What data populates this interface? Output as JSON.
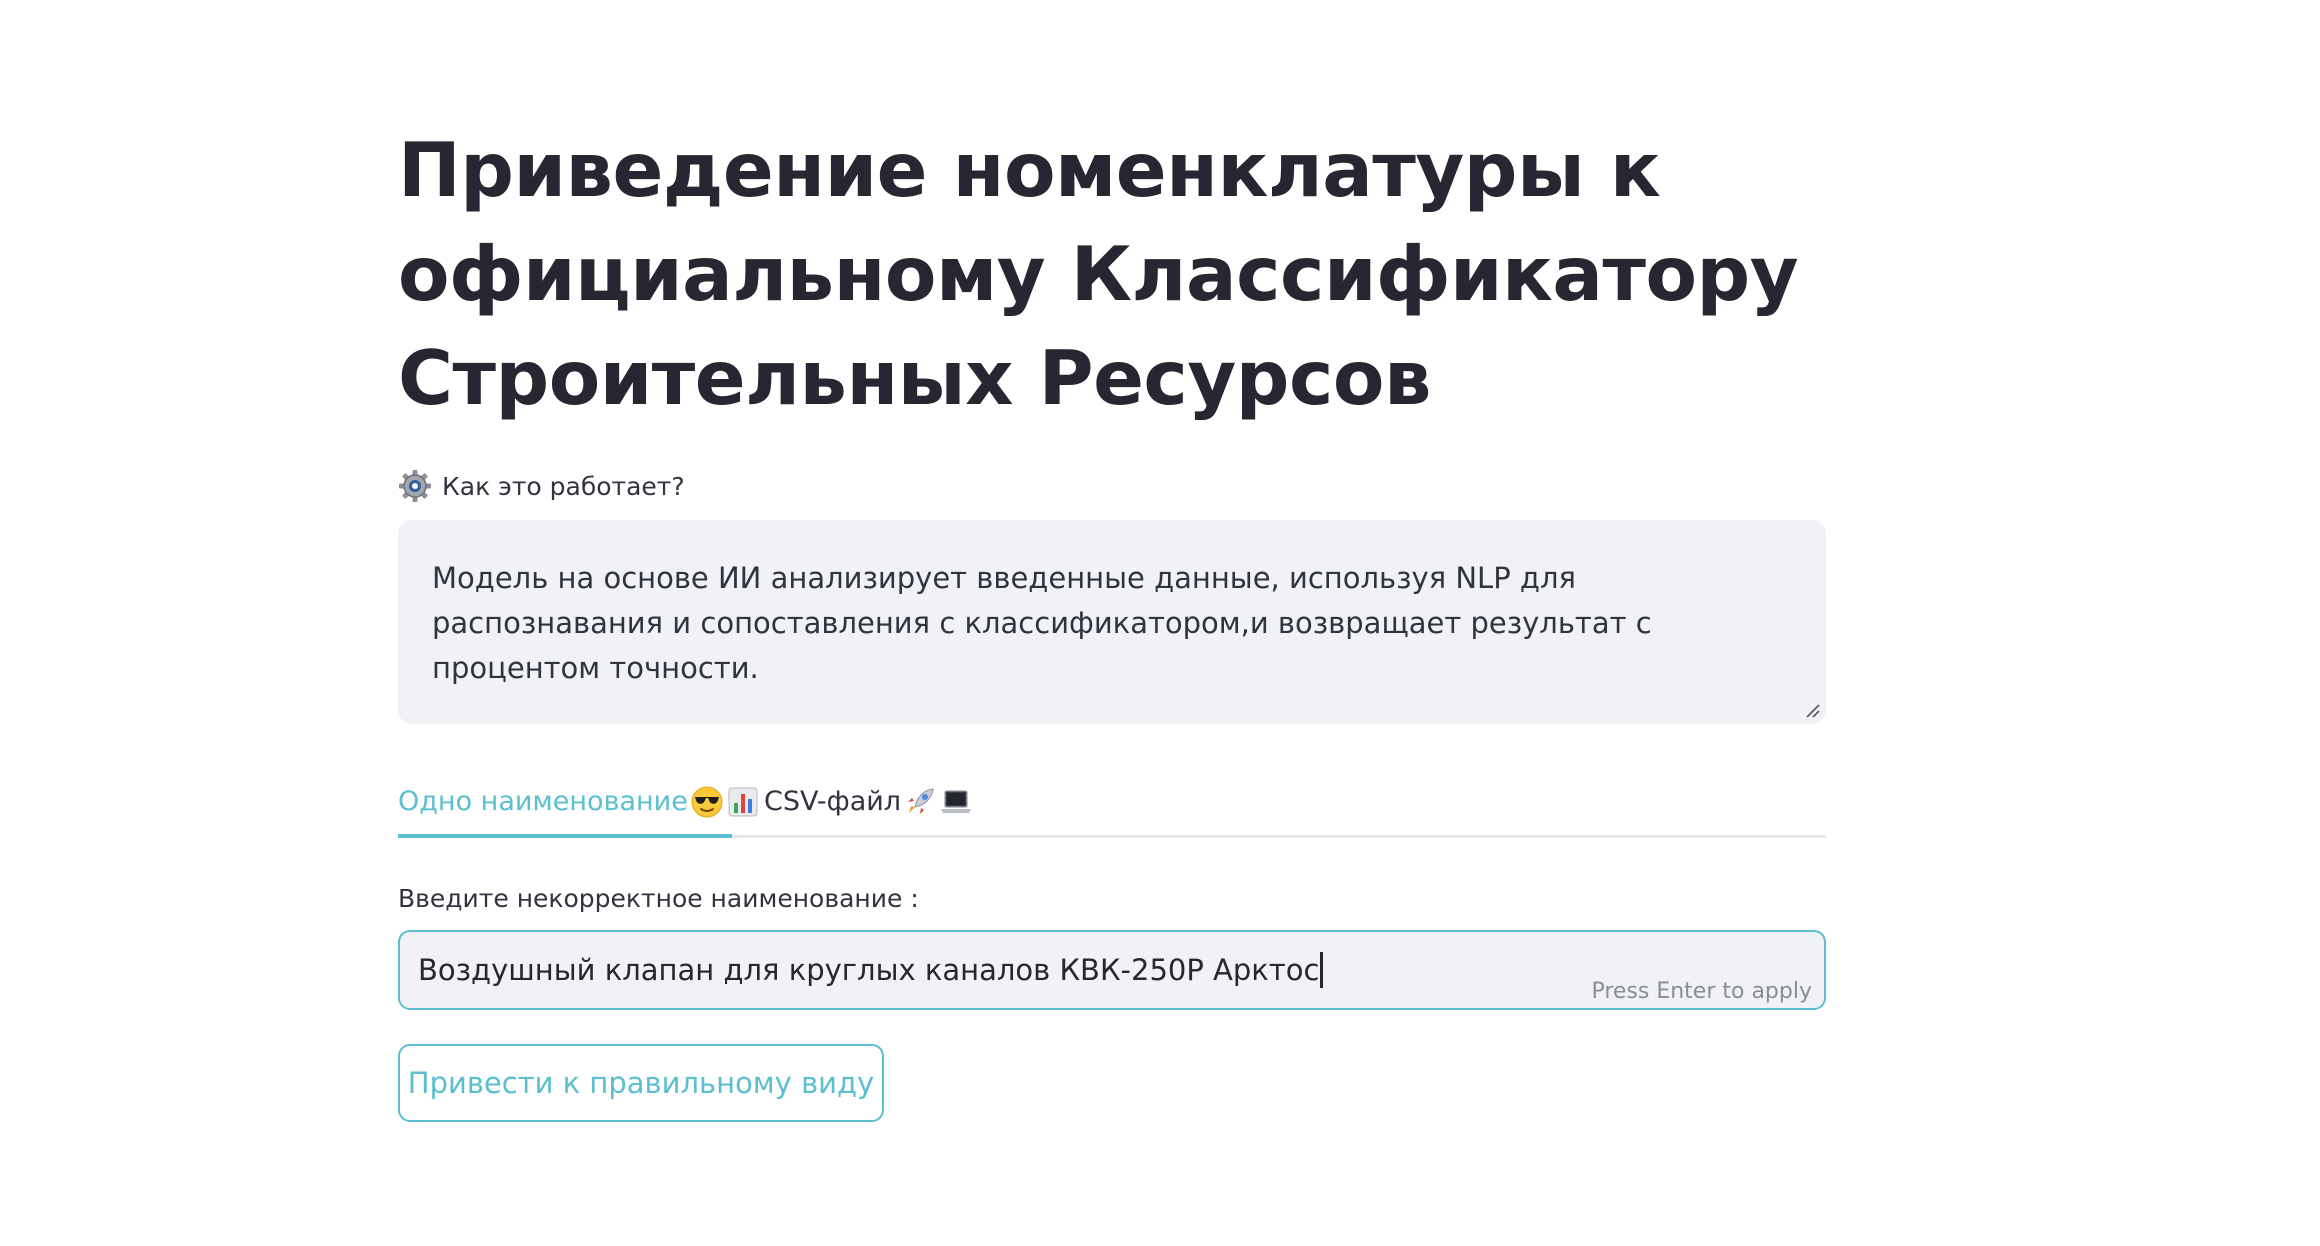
{
  "page": {
    "title": "Приведение номенклатуры к официальному Классификатору Строительных Ресурсов"
  },
  "how_it_works": {
    "icon": "gear-icon",
    "label": "Как это работает?",
    "text": "Модель на основе ИИ анализирует введенные данные, используя NLP для распознавания и сопоставления с классификатором,и возвращает результат с процентом точности."
  },
  "tabs": [
    {
      "label": "Одно наименование",
      "icons": [
        "sunglasses-emoji-icon",
        "bar-chart-emoji-icon"
      ],
      "active": true
    },
    {
      "label": "CSV-файл",
      "icons": [
        "rocket-emoji-icon",
        "laptop-emoji-icon"
      ],
      "active": false
    }
  ],
  "form": {
    "input_label": "Введите некорректное наименование :",
    "input_value": "Воздушный клапан для круглых каналов КВК-250Р Арктос",
    "input_hint": "Press Enter to apply",
    "submit_label": "Привести к правильному виду"
  },
  "colors": {
    "accent": "#5bbfcf",
    "text": "#262730",
    "field_background": "#f0f2f6"
  }
}
